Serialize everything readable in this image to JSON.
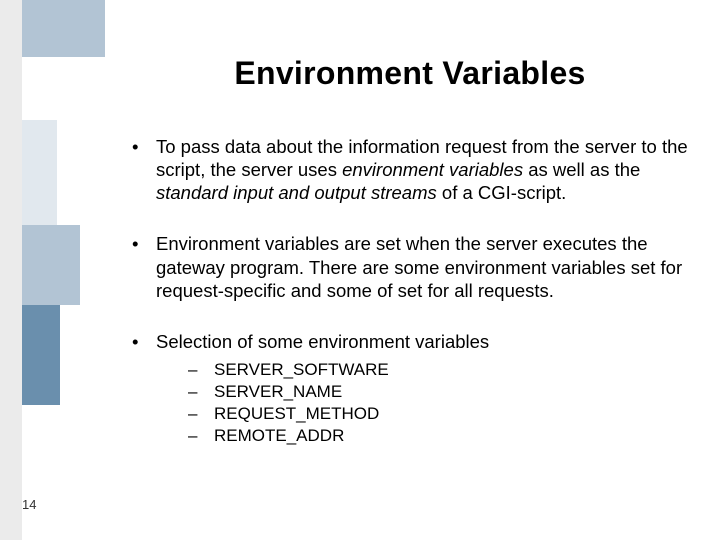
{
  "page_number": "14",
  "title": "Environment Variables",
  "bullets": [
    {
      "pre": "To pass data about the information request from the server to the script, the server uses ",
      "em1": "environment variables",
      "mid": " as well as the ",
      "em2": "standard input and output streams",
      "post": " of a CGI-script."
    },
    {
      "text": "Environment variables are set when the server executes the gateway program. There are some environment variables set for request-specific and some of set for all requests."
    },
    {
      "text": "Selection of some environment variables"
    }
  ],
  "sub_items": [
    "SERVER_SOFTWARE",
    "SERVER_NAME",
    "REQUEST_METHOD",
    "REMOTE_ADDR"
  ]
}
